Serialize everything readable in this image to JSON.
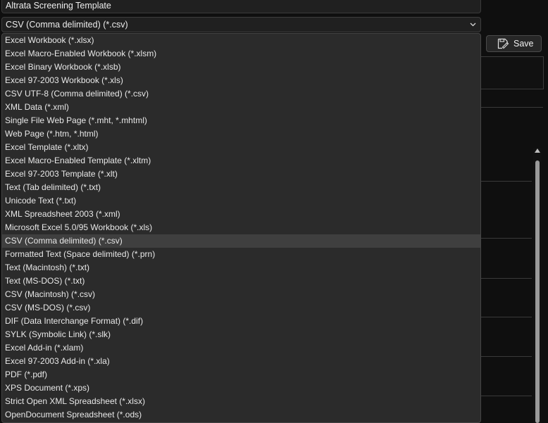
{
  "filename": {
    "value": "Altrata Screening Template"
  },
  "save_as_type": {
    "selected": "CSV (Comma delimited) (*.csv)",
    "options": [
      "Excel Workbook (*.xlsx)",
      "Excel Macro-Enabled Workbook (*.xlsm)",
      "Excel Binary Workbook (*.xlsb)",
      "Excel 97-2003 Workbook (*.xls)",
      "CSV UTF-8 (Comma delimited) (*.csv)",
      "XML Data (*.xml)",
      "Single File Web Page (*.mht, *.mhtml)",
      "Web Page (*.htm, *.html)",
      "Excel Template (*.xltx)",
      "Excel Macro-Enabled Template (*.xltm)",
      "Excel 97-2003 Template (*.xlt)",
      "Text (Tab delimited) (*.txt)",
      "Unicode Text (*.txt)",
      "XML Spreadsheet 2003 (*.xml)",
      "Microsoft Excel 5.0/95 Workbook (*.xls)",
      "CSV (Comma delimited) (*.csv)",
      "Formatted Text (Space delimited) (*.prn)",
      "Text (Macintosh) (*.txt)",
      "Text (MS-DOS) (*.txt)",
      "CSV (Macintosh) (*.csv)",
      "CSV (MS-DOS) (*.csv)",
      "DIF (Data Interchange Format) (*.dif)",
      "SYLK (Symbolic Link) (*.slk)",
      "Excel Add-in (*.xlam)",
      "Excel 97-2003 Add-in (*.xla)",
      "PDF (*.pdf)",
      "XPS Document (*.xps)",
      "Strict Open XML Spreadsheet (*.xlsx)",
      "OpenDocument Spreadsheet (*.ods)"
    ],
    "selected_index": 15
  },
  "toolbar": {
    "save_label": "Save",
    "save_icon": "save-disk-icon"
  },
  "colors": {
    "background": "#0f0f0f",
    "dropdown_bg": "#2b2b2b",
    "selected_bg": "#3f3f3f",
    "text": "#e8e8e8"
  }
}
